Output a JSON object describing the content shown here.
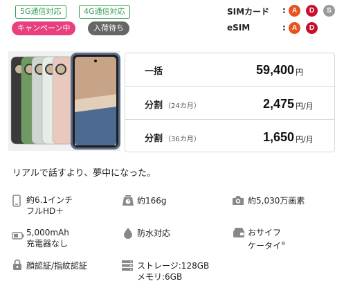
{
  "tags": [
    {
      "label": "5G通信対応"
    },
    {
      "label": "4G通信対応"
    }
  ],
  "badges": [
    {
      "label": "キャンペーン中",
      "color": "#e8407f"
    },
    {
      "label": "入荷待ち",
      "color": "#666666"
    }
  ],
  "sim": {
    "rows": [
      {
        "label": "SIMカード",
        "colon": ":",
        "carriers": [
          "A",
          "D",
          "S"
        ]
      },
      {
        "label": "eSIM",
        "colon": ":",
        "carriers": [
          "A",
          "D"
        ]
      }
    ],
    "carrier_colors": {
      "A": "#e8541f",
      "D": "#c8102e",
      "S": "#9a9a9a"
    }
  },
  "phone_colors": [
    "#3a3a3a",
    "#6f9a62",
    "#cfd6cf",
    "#e6ede8",
    "#e9c9bd",
    "#4d6a92"
  ],
  "prices": [
    {
      "label": "一括",
      "sub": "",
      "value": "59,400",
      "unit": "円"
    },
    {
      "label": "分割",
      "sub": "（24カ月）",
      "value": "2,475",
      "unit": "円/月"
    },
    {
      "label": "分割",
      "sub": "（36カ月）",
      "value": "1,650",
      "unit": "円/月"
    }
  ],
  "tagline": "リアルで話すより、夢中になった。",
  "specs": {
    "display": {
      "line1": "約6.1インチ",
      "line2": "フルHD＋"
    },
    "weight": {
      "line1": "約166g"
    },
    "camera": {
      "line1": "約5,030万画素"
    },
    "battery": {
      "line1": "5,000mAh",
      "line2": "充電器なし"
    },
    "waterproof": {
      "line1": "防水対応"
    },
    "wallet": {
      "line1": "おサイフ",
      "line2": "ケータイ",
      "mark": "®"
    },
    "auth": {
      "line1": "顔認証/指紋認証"
    },
    "storage": {
      "line1": "ストレージ:128GB",
      "line2": "メモリ:6GB"
    }
  }
}
